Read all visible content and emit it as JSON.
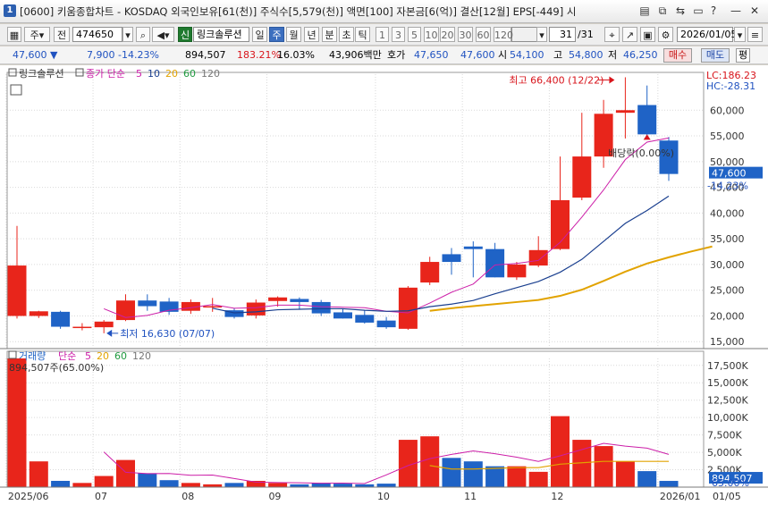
{
  "window": {
    "badge": "1",
    "title": "[0600] 키움종합차트 - KOSDAQ 외국인보유[61(천)] 주식수[5,579(천)] 액면[100] 자본금[6(억)] 결산[12월] EPS[-449] 시",
    "buttons": [
      "?",
      "□",
      "⧉",
      "⇆",
      "?",
      "—",
      "✕"
    ]
  },
  "toolbar": {
    "market": "주",
    "period_type": "전",
    "code": "474650",
    "new_badge": "신",
    "stock_name": "링크솔루션",
    "periods": [
      "일",
      "주",
      "월",
      "년",
      "분",
      "초",
      "틱"
    ],
    "selected_period": "주",
    "numbers": [
      "1",
      "3",
      "5",
      "10",
      "20",
      "30",
      "60",
      "120"
    ],
    "count_value": "31",
    "count_total": "/31",
    "date": "2026/01/05"
  },
  "quote": {
    "price": "47,600",
    "change": "7,900",
    "change_pct": "-14.23%",
    "volume": "894,507",
    "vol_pct": "183.21%",
    "turnover": "16.03%",
    "amount": "43,906백만",
    "ho_label": "호가",
    "ask": "47,650",
    "bid": "47,600",
    "open_label": "시",
    "open": "54,100",
    "high_label": "고",
    "high": "54,800",
    "low_label": "저",
    "low": "46,250",
    "buy": "매수",
    "sell": "매도",
    "eval": "평"
  },
  "chart": {
    "legend_name": "링크솔루션",
    "legend_label": "종가 단순",
    "ma_periods": [
      "5",
      "10",
      "20",
      "60",
      "120"
    ],
    "lc": "LC:186.23",
    "hc": "HC:-28.31",
    "price_ticks": [
      15000,
      20000,
      25000,
      30000,
      35000,
      40000,
      45000,
      50000,
      55000,
      60000
    ],
    "price_tick_labels": [
      "15,000",
      "20,000",
      "25,000",
      "30,000",
      "35,000",
      "40,000",
      "45,000",
      "50,000",
      "55,000",
      "60,000"
    ],
    "current_price_label": "47,600",
    "current_change_label": "-14.23%",
    "high_annot": "최고 66,400 (12/22)",
    "low_annot": "최저 16,630 (07/07)",
    "dividend_annot": "배당락(0.00%)",
    "volume_legend_name": "거래량",
    "volume_legend_label": "단순",
    "volume_ma_periods": [
      "5",
      "20",
      "60",
      "120"
    ],
    "volume_info": "894,507주(65.00%)",
    "volume_ticks": [
      2500,
      5000,
      7500,
      10000,
      12500,
      15000,
      17500
    ],
    "volume_tick_labels": [
      "2,500K",
      "5,000K",
      "7,500K",
      "10,000K",
      "12,500K",
      "15,000K",
      "17,500K"
    ],
    "current_volume_label": "894,507",
    "current_volume_pct": "65.00%",
    "x_labels": [
      "2025/06",
      "07",
      "08",
      "09",
      "10",
      "11",
      "12",
      "2026/01",
      "01/05"
    ],
    "colors": {
      "up": "#e8251b",
      "down": "#1f63c6",
      "ma5": "#cc1ea8",
      "ma10": "#1a3f8f",
      "ma20": "#e2a300",
      "red_text": "#d8141b",
      "blue_text": "#2052c0"
    }
  },
  "chart_data": {
    "type": "candlestick",
    "xlabel": "",
    "ylabel": "",
    "ylim": [
      14000,
      67000
    ],
    "volume_ylim": [
      0,
      18500
    ],
    "candles": [
      {
        "o": 20000,
        "h": 37500,
        "l": 19500,
        "c": 29800,
        "v": 18500
      },
      {
        "o": 20000,
        "h": 21000,
        "l": 19600,
        "c": 20900,
        "v": 3700
      },
      {
        "o": 20800,
        "h": 21000,
        "l": 17500,
        "c": 17900,
        "v": 900
      },
      {
        "o": 17900,
        "h": 18600,
        "l": 17200,
        "c": 17900,
        "v": 600
      },
      {
        "o": 17800,
        "h": 19200,
        "l": 16630,
        "c": 18900,
        "v": 1600
      },
      {
        "o": 19200,
        "h": 24200,
        "l": 19000,
        "c": 23000,
        "v": 3900
      },
      {
        "o": 23000,
        "h": 24200,
        "l": 21000,
        "c": 21900,
        "v": 2000
      },
      {
        "o": 22800,
        "h": 23500,
        "l": 20200,
        "c": 20800,
        "v": 1000
      },
      {
        "o": 21000,
        "h": 23200,
        "l": 20400,
        "c": 22700,
        "v": 600
      },
      {
        "o": 21900,
        "h": 23500,
        "l": 20800,
        "c": 21900,
        "v": 400
      },
      {
        "o": 21100,
        "h": 21500,
        "l": 19500,
        "c": 19800,
        "v": 600
      },
      {
        "o": 20100,
        "h": 23200,
        "l": 19500,
        "c": 22600,
        "v": 900
      },
      {
        "o": 22900,
        "h": 23800,
        "l": 21800,
        "c": 23600,
        "v": 600
      },
      {
        "o": 23300,
        "h": 23600,
        "l": 21200,
        "c": 22700,
        "v": 400
      },
      {
        "o": 22700,
        "h": 23100,
        "l": 20000,
        "c": 20500,
        "v": 600
      },
      {
        "o": 20700,
        "h": 21400,
        "l": 19500,
        "c": 19500,
        "v": 500
      },
      {
        "o": 20200,
        "h": 21100,
        "l": 18500,
        "c": 18700,
        "v": 400
      },
      {
        "o": 19100,
        "h": 19800,
        "l": 17500,
        "c": 17800,
        "v": 500
      },
      {
        "o": 17500,
        "h": 25800,
        "l": 17300,
        "c": 25500,
        "v": 6800
      },
      {
        "o": 26500,
        "h": 31500,
        "l": 26000,
        "c": 30500,
        "v": 7300
      },
      {
        "o": 32000,
        "h": 33200,
        "l": 28000,
        "c": 30500,
        "v": 4200
      },
      {
        "o": 33500,
        "h": 34500,
        "l": 27500,
        "c": 33000,
        "v": 3700
      },
      {
        "o": 33000,
        "h": 34200,
        "l": 27500,
        "c": 27500,
        "v": 3000
      },
      {
        "o": 27500,
        "h": 30500,
        "l": 27000,
        "c": 30000,
        "v": 3000
      },
      {
        "o": 29800,
        "h": 35500,
        "l": 29500,
        "c": 32800,
        "v": 2200
      },
      {
        "o": 33000,
        "h": 51000,
        "l": 32800,
        "c": 42500,
        "v": 10200
      },
      {
        "o": 43000,
        "h": 59500,
        "l": 42500,
        "c": 51000,
        "v": 6800
      },
      {
        "o": 51000,
        "h": 62000,
        "l": 48800,
        "c": 59300,
        "v": 5900
      },
      {
        "o": 59500,
        "h": 66400,
        "l": 54500,
        "c": 60000,
        "v": 3700
      },
      {
        "o": 61000,
        "h": 64800,
        "l": 54500,
        "c": 55300,
        "v": 2300
      },
      {
        "o": 54100,
        "h": 54800,
        "l": 46250,
        "c": 47600,
        "v": 894.507
      }
    ],
    "ma5": [
      null,
      null,
      null,
      null,
      21400,
      19700,
      20100,
      21100,
      21600,
      22200,
      21500,
      21600,
      22100,
      22100,
      21800,
      21700,
      21600,
      20900,
      20600,
      22500,
      24600,
      26200,
      29900,
      30200,
      30800,
      34300,
      39200,
      44500,
      50400,
      53800,
      54600
    ],
    "ma10": [
      null,
      null,
      null,
      null,
      null,
      null,
      null,
      null,
      null,
      21500,
      20600,
      20800,
      21200,
      21300,
      21400,
      21400,
      21100,
      20900,
      21000,
      21800,
      22300,
      23000,
      24300,
      25500,
      26700,
      28500,
      31000,
      34500,
      38000,
      40500,
      43300
    ],
    "ma20": [
      null,
      null,
      null,
      null,
      null,
      null,
      null,
      null,
      null,
      null,
      null,
      null,
      null,
      null,
      null,
      null,
      null,
      null,
      null,
      21000,
      21500,
      21900,
      22300,
      22700,
      23100,
      23900,
      25100,
      26800,
      28600,
      30200,
      31400,
      32500,
      33500
    ],
    "vol_ma5": [
      null,
      null,
      null,
      null,
      5060,
      2140,
      1940,
      1960,
      1700,
      1740,
      1240,
      720,
      660,
      620,
      560,
      580,
      520,
      1760,
      3100,
      4100,
      4700,
      5200,
      4800,
      4300,
      3700,
      4500,
      5400,
      6300,
      5900,
      5600,
      4700
    ],
    "vol_ma20": [
      null,
      null,
      null,
      null,
      null,
      null,
      null,
      null,
      null,
      null,
      null,
      null,
      null,
      null,
      null,
      null,
      null,
      null,
      null,
      3100,
      2600,
      2600,
      2700,
      2800,
      2800,
      3300,
      3500,
      3700,
      3700,
      3700,
      3700
    ]
  }
}
